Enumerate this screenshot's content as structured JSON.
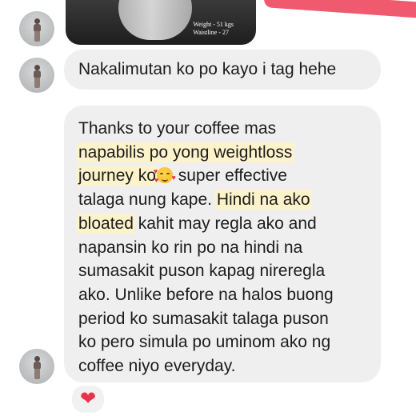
{
  "top_photo": {
    "caption_line1": "Weight - 51 kgs",
    "caption_line2": "Waistline - 27"
  },
  "messages": [
    {
      "text": "Nakalimutan ko po kayo i tag hehe"
    },
    {
      "lines": [
        {
          "segments": [
            {
              "text": "Thanks to your coffee mas"
            }
          ]
        },
        {
          "segments": [
            {
              "text": "napabilis po yong weightloss",
              "highlight": true
            }
          ]
        },
        {
          "segments": [
            {
              "text": "journey ko",
              "highlight": true
            },
            {
              "emoji": "smiling-face-with-hearts-icon"
            },
            {
              "text": " super effective"
            }
          ]
        },
        {
          "segments": [
            {
              "text": "talaga nung kape. "
            },
            {
              "text": "Hindi na ako",
              "highlight": true
            }
          ]
        },
        {
          "segments": [
            {
              "text": "bloated",
              "highlight": true
            },
            {
              "text": " kahit may regla ako and"
            }
          ]
        },
        {
          "segments": [
            {
              "text": "napansin ko rin po na hindi na"
            }
          ]
        },
        {
          "segments": [
            {
              "text": "sumasakit puson kapag nireregla"
            }
          ]
        },
        {
          "segments": [
            {
              "text": "ako. Unlike before na halos buong"
            }
          ]
        },
        {
          "segments": [
            {
              "text": "period ko sumasakit talaga puson"
            }
          ]
        },
        {
          "segments": [
            {
              "text": "ko pero simula po uminom ako ng"
            }
          ]
        },
        {
          "segments": [
            {
              "text": "coffee niyo everyday."
            }
          ]
        }
      ]
    }
  ],
  "reaction": {
    "icon": "red-heart-icon",
    "glyph": "❤"
  },
  "colors": {
    "bubble": "#efeff0",
    "highlight": "#fdf3cb",
    "accent_red": "#f05a6e",
    "heart": "#e8344a"
  }
}
